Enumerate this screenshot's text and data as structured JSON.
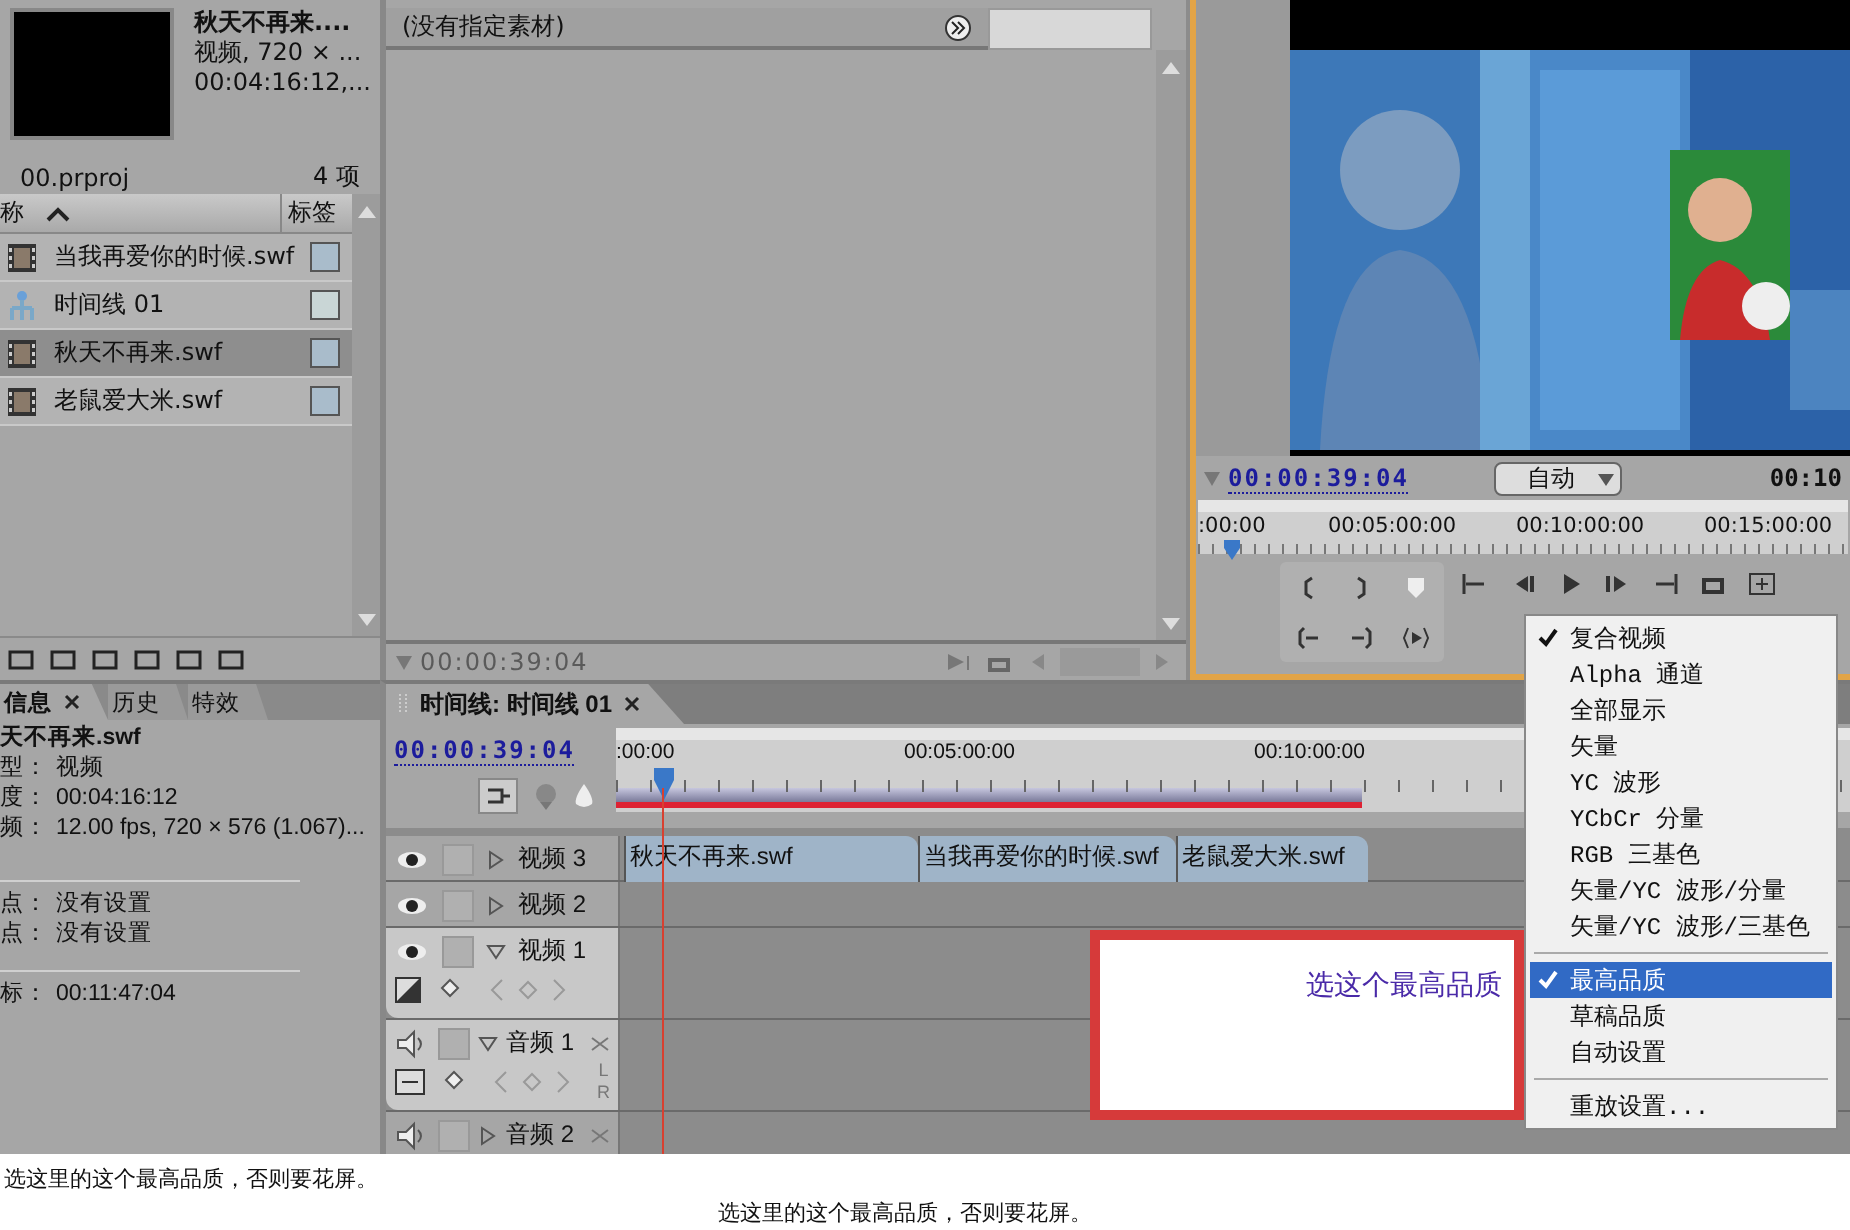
{
  "project_panel": {
    "clip_title": "秋天不再来....",
    "clip_info": [
      "视频, 720 × ...",
      "00:04:16:12,..."
    ],
    "project_name": "00.prproj",
    "item_count": "4 项",
    "columns": [
      "称",
      "标签"
    ],
    "items": [
      {
        "name": "当我再爱你的时候.swf",
        "kind": "clip",
        "selected": false,
        "color": "#a9bccb"
      },
      {
        "name": "时间线 01",
        "kind": "sequence",
        "selected": false,
        "color": "#c9d6d6"
      },
      {
        "name": "秋天不再来.swf",
        "kind": "clip",
        "selected": true,
        "color": "#a9bccb"
      },
      {
        "name": "老鼠爱大米.swf",
        "kind": "clip",
        "selected": false,
        "color": "#a9bccb"
      }
    ]
  },
  "source_panel": {
    "title": "(没有指定素材)",
    "timecode": "00:00:39:04"
  },
  "program_monitor": {
    "timecode": "00:00:39:04",
    "zoom": "自动",
    "duration": "00:10",
    "ruler": [
      ":00:00",
      "00:05:00:00",
      "00:10:00:00",
      "00:15:00:00"
    ]
  },
  "info_panel": {
    "tabs": [
      {
        "label": "信息",
        "selected": true
      },
      {
        "label": "历史",
        "selected": false
      },
      {
        "label": "特效",
        "selected": false
      }
    ],
    "title": "天不再来.swf",
    "groups": [
      [
        {
          "label": "型：",
          "value": "视频"
        },
        {
          "label": "度：",
          "value": "00:04:16:12"
        },
        {
          "label": "频：",
          "value": "12.00 fps, 720 × 576 (1.067)..."
        }
      ],
      [
        {
          "label": "点：",
          "value": "没有设置"
        },
        {
          "label": "点：",
          "value": "没有设置"
        }
      ],
      [
        {
          "label": "标：",
          "value": "00:11:47:04"
        }
      ]
    ]
  },
  "timeline": {
    "tab": "时间线: 时间线 01",
    "timecode": "00:00:39:04",
    "ruler": [
      ":00:00",
      "00:05:00:00",
      "00:10:00:00"
    ],
    "tracks": [
      {
        "name": "视频 3",
        "kind": "video",
        "expanded": false,
        "clips": [
          "秋天不再来.swf",
          "当我再爱你的时候.swf",
          "老鼠爱大米.swf"
        ]
      },
      {
        "name": "视频 2",
        "kind": "video",
        "expanded": false
      },
      {
        "name": "视频 1",
        "kind": "video",
        "expanded": true
      },
      {
        "name": "音频 1",
        "kind": "audio",
        "expanded": true,
        "channels": [
          "L",
          "R"
        ]
      },
      {
        "name": "音频 2",
        "kind": "audio",
        "expanded": false
      }
    ]
  },
  "menu": {
    "items": [
      {
        "kind": "item",
        "label": "复合视频",
        "checked": true,
        "selected": false
      },
      {
        "kind": "item",
        "label": "Alpha 通道",
        "checked": false,
        "selected": false
      },
      {
        "kind": "item",
        "label": "全部显示",
        "checked": false,
        "selected": false
      },
      {
        "kind": "item",
        "label": "矢量",
        "checked": false,
        "selected": false
      },
      {
        "kind": "item",
        "label": "YC 波形",
        "checked": false,
        "selected": false
      },
      {
        "kind": "item",
        "label": "YCbCr 分量",
        "checked": false,
        "selected": false
      },
      {
        "kind": "item",
        "label": "RGB 三基色",
        "checked": false,
        "selected": false
      },
      {
        "kind": "item",
        "label": "矢量/YC 波形/分量",
        "checked": false,
        "selected": false
      },
      {
        "kind": "item",
        "label": "矢量/YC 波形/三基色",
        "checked": false,
        "selected": false
      },
      {
        "kind": "separator"
      },
      {
        "kind": "item",
        "label": "最高品质",
        "checked": true,
        "selected": true
      },
      {
        "kind": "item",
        "label": "草稿品质",
        "checked": false,
        "selected": false
      },
      {
        "kind": "item",
        "label": "自动设置",
        "checked": false,
        "selected": false
      },
      {
        "kind": "separator"
      },
      {
        "kind": "item",
        "label": "重放设置...",
        "checked": false,
        "selected": false
      }
    ]
  },
  "callout": {
    "text": "选这个最高品质"
  },
  "captions": [
    "选这里的这个最高品质，否则要花屏。",
    "选这里的这个最高品质，否则要花屏。"
  ]
}
